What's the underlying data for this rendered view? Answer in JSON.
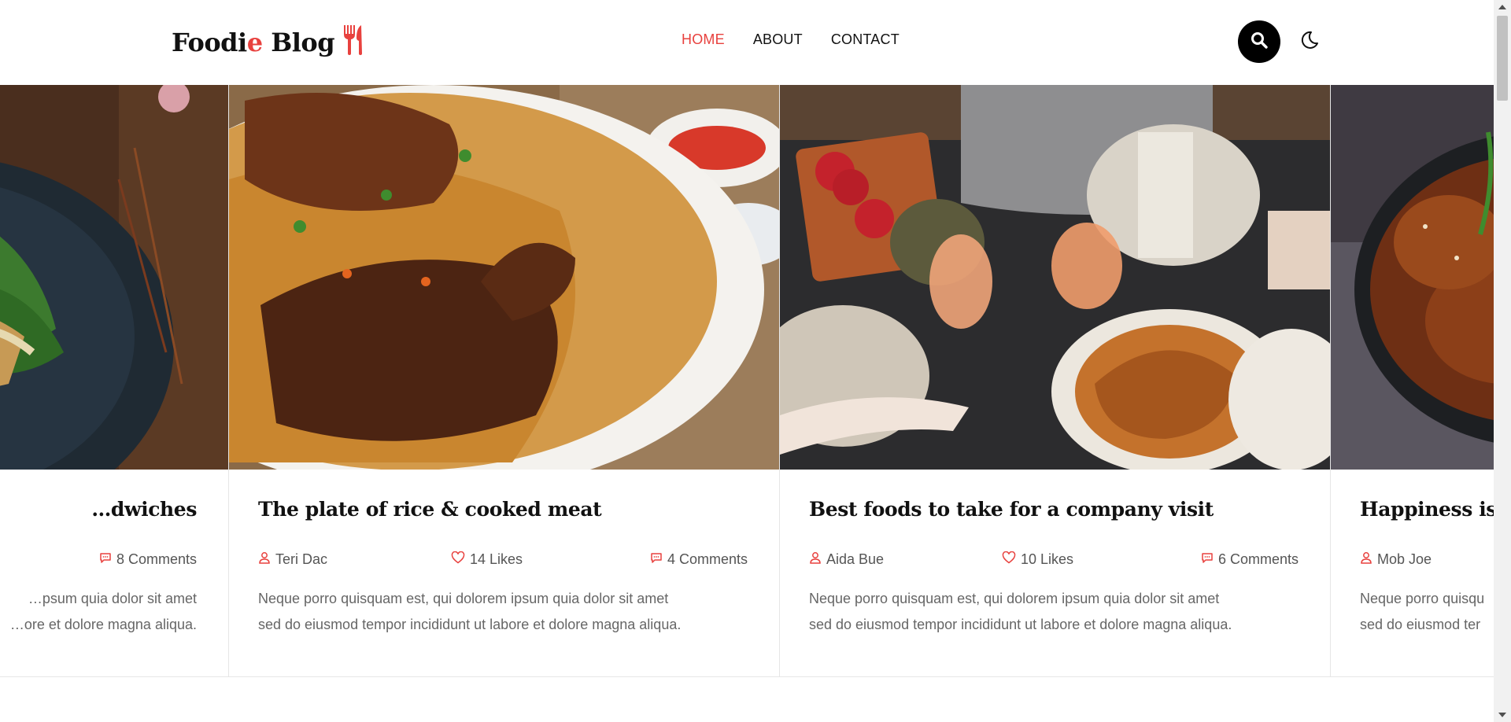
{
  "logo": {
    "text_a": "Foodi",
    "text_b": "e",
    "text_c": " Blog"
  },
  "nav": [
    {
      "label": "HOME"
    },
    {
      "label": "ABOUT"
    },
    {
      "label": "CONTACT"
    }
  ],
  "colors": {
    "accent": "#e8413e",
    "text": "#111111",
    "muted": "#666666"
  },
  "icons": {
    "search": "search-icon",
    "theme": "moon-icon",
    "logo": "fork-knife-icon"
  },
  "cards": [
    {
      "title": "…dwiches",
      "author": "",
      "likes": "",
      "comments": "8 Comments",
      "excerpt_l1": "…psum quia dolor sit amet",
      "excerpt_l2": "…ore et dolore magna aliqua."
    },
    {
      "title": "The plate of rice & cooked meat",
      "author": "Teri Dac",
      "likes": "14 Likes",
      "comments": "4 Comments",
      "excerpt_l1": "Neque porro quisquam est, qui dolorem ipsum quia dolor sit amet",
      "excerpt_l2": "sed do eiusmod tempor incididunt ut labore et dolore magna aliqua."
    },
    {
      "title": "Best foods to take for a company visit",
      "author": "Aida Bue",
      "likes": "10 Likes",
      "comments": "6 Comments",
      "excerpt_l1": "Neque porro quisquam est, qui dolorem ipsum quia dolor sit amet",
      "excerpt_l2": "sed do eiusmod tempor incididunt ut labore et dolore magna aliqua."
    },
    {
      "title": "Happiness is a",
      "author": "Mob Joe",
      "likes": "",
      "comments": "",
      "excerpt_l1": "Neque porro quisqu",
      "excerpt_l2": "sed do eiusmod ter"
    }
  ]
}
